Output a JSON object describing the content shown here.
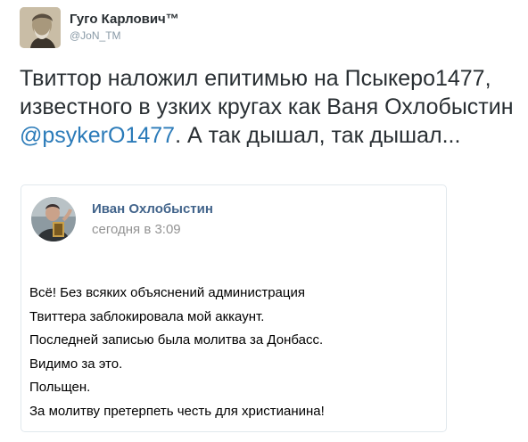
{
  "colors": {
    "mention": "#2b7bb9",
    "vk_name": "#42648b",
    "muted": "#8899a6",
    "border": "#e1e8ed"
  },
  "tweet": {
    "author": {
      "display_name": "Гуго Карлович™",
      "handle": "@JoN_TM",
      "avatar_icon": "user-avatar-portrait"
    },
    "text_before_mention": "Твиттор наложил епитимью на Псыкеро1477, известного в узких кругах как Ваня Охлобыстин ",
    "mention": "@psykerO1477",
    "text_after_mention": ". А так дышал, так дышал...",
    "embed": {
      "author": "Иван Охлобыстин",
      "time": "сегодня в 3:09",
      "avatar_icon": "profile-photo",
      "lines": [
        "Всё! Без всяких объяснений администрация",
        "Твиттера заблокировала мой аккаунт.",
        "Последней записью была молитва за Донбасс.",
        "Видимо за это.",
        "Польщен.",
        "За молитву претерпеть честь для христианина!"
      ]
    }
  }
}
